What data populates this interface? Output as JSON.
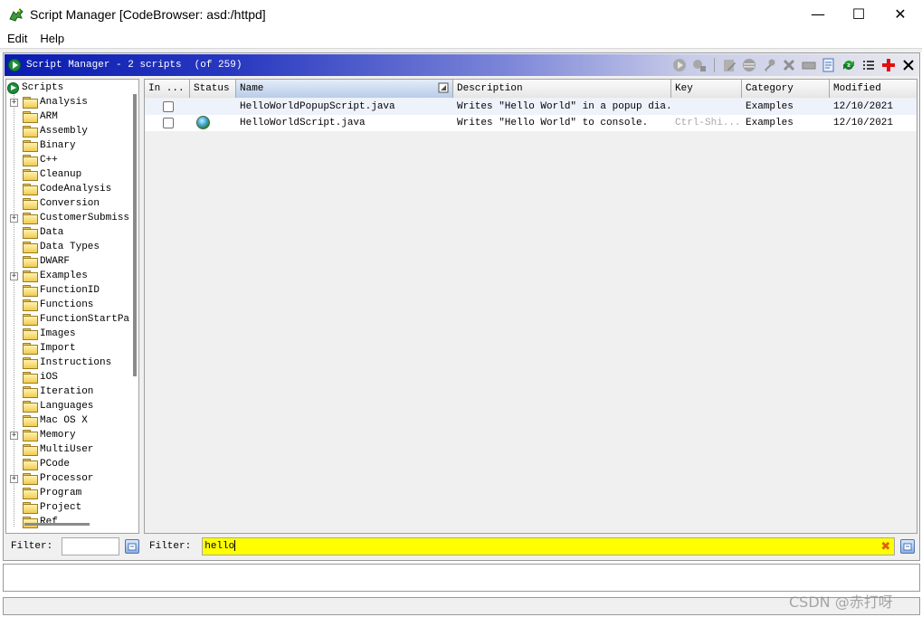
{
  "window": {
    "title": "Script Manager [CodeBrowser: asd:/httpd]",
    "app_icon": "ghidra-dragon-icon",
    "controls": {
      "minimize": "—",
      "maximize": "☐",
      "close": "✕"
    }
  },
  "menu": {
    "items": [
      "Edit",
      "Help"
    ]
  },
  "header": {
    "title": "Script Manager - 2 scripts",
    "subtitle": "(of 259)"
  },
  "toolbar": {
    "icons": [
      "run-script-icon",
      "run-last-script-icon",
      "edit-script-icon",
      "edit-eclipse-icon",
      "key-binding-icon",
      "delete-script-icon",
      "rename-script-icon",
      "new-script-icon",
      "refresh-icon",
      "script-directories-icon",
      "help-icon",
      "close-icon"
    ]
  },
  "tree": {
    "root_label": "Scripts",
    "items": [
      {
        "label": "Analysis",
        "expandable": true
      },
      {
        "label": "ARM",
        "expandable": false
      },
      {
        "label": "Assembly",
        "expandable": false
      },
      {
        "label": "Binary",
        "expandable": false
      },
      {
        "label": "C++",
        "expandable": false
      },
      {
        "label": "Cleanup",
        "expandable": false
      },
      {
        "label": "CodeAnalysis",
        "expandable": false
      },
      {
        "label": "Conversion",
        "expandable": false
      },
      {
        "label": "CustomerSubmiss",
        "expandable": true
      },
      {
        "label": "Data",
        "expandable": false
      },
      {
        "label": "Data Types",
        "expandable": false
      },
      {
        "label": "DWARF",
        "expandable": false
      },
      {
        "label": "Examples",
        "expandable": true
      },
      {
        "label": "FunctionID",
        "expandable": false
      },
      {
        "label": "Functions",
        "expandable": false
      },
      {
        "label": "FunctionStartPa",
        "expandable": false
      },
      {
        "label": "Images",
        "expandable": false
      },
      {
        "label": "Import",
        "expandable": false
      },
      {
        "label": "Instructions",
        "expandable": false
      },
      {
        "label": "iOS",
        "expandable": false
      },
      {
        "label": "Iteration",
        "expandable": false
      },
      {
        "label": "Languages",
        "expandable": false
      },
      {
        "label": "Mac OS X",
        "expandable": false
      },
      {
        "label": "Memory",
        "expandable": true
      },
      {
        "label": "MultiUser",
        "expandable": false
      },
      {
        "label": "PCode",
        "expandable": false
      },
      {
        "label": "Processor",
        "expandable": true
      },
      {
        "label": "Program",
        "expandable": false
      },
      {
        "label": "Project",
        "expandable": false
      },
      {
        "label": "Ref",
        "expandable": false
      }
    ]
  },
  "left_filter": {
    "label": "Filter:",
    "value": ""
  },
  "table": {
    "columns": [
      "In ...",
      "Status",
      "Name",
      "Description",
      "Key",
      "Category",
      "Modified"
    ],
    "sorted_column": "Name",
    "rows": [
      {
        "in_tool": false,
        "status_icon": "",
        "name": "HelloWorldPopupScript.java",
        "description": "Writes \"Hello World\" in a popup dia...",
        "key": "",
        "category": "Examples",
        "modified": "12/10/2021"
      },
      {
        "in_tool": false,
        "status_icon": "globe-status-icon",
        "name": "HelloWorldScript.java",
        "description": "Writes \"Hello World\" to console.",
        "key": "Ctrl-Shi...",
        "category": "Examples",
        "modified": "12/10/2021"
      }
    ]
  },
  "right_filter": {
    "label": "Filter:",
    "value": "hello"
  },
  "watermark": "CSDN @赤打呀",
  "colors": {
    "header_start": "#0a1cb0",
    "filter_highlight": "#ffff00",
    "alt_row": "#eef2fb"
  }
}
